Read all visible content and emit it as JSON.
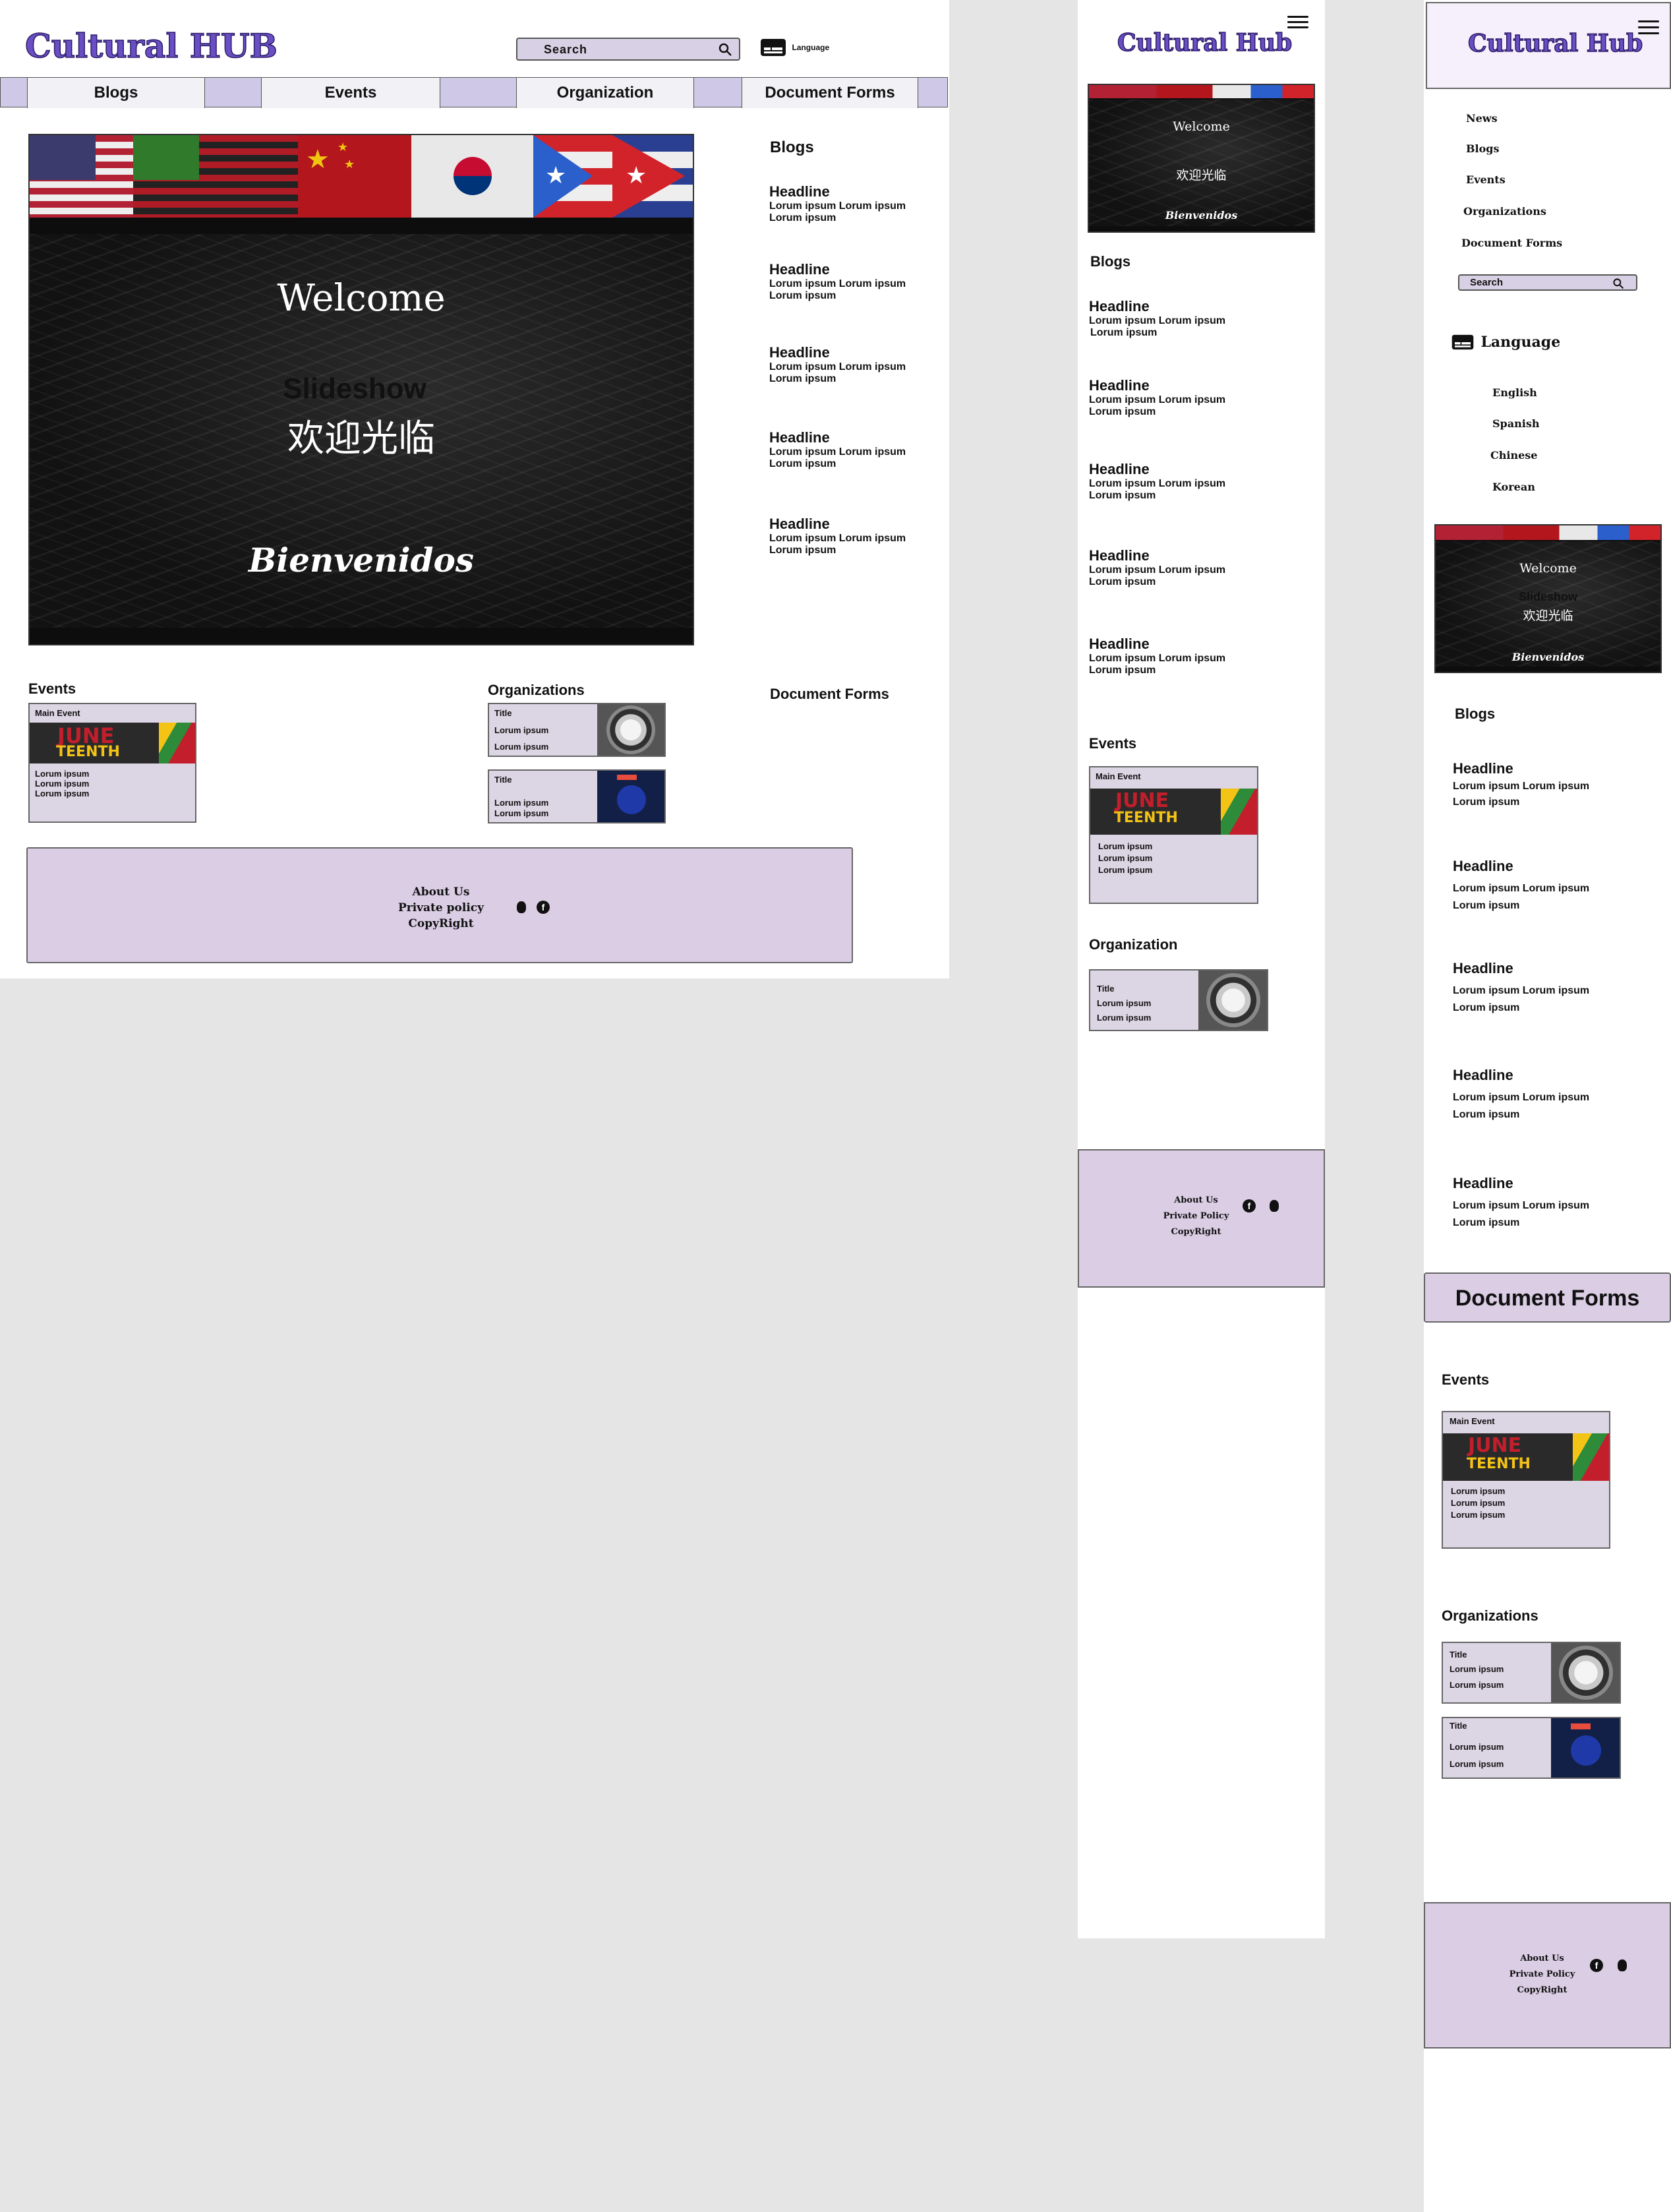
{
  "desktop": {
    "logo": "Cultural HUB",
    "search_placeholder": "Search",
    "language_label": "Language",
    "nav": [
      "Blogs",
      "Events",
      "Organization",
      "Document Forms"
    ],
    "hero": {
      "welcome": "Welcome",
      "slideshow": "Slideshow",
      "chinese": "欢迎光临",
      "spanish": "Bienvenidos"
    },
    "blogs_title": "Blogs",
    "blogs": [
      {
        "headline": "Headline",
        "l1": "Lorum ipsum Lorum ipsum",
        "l2": "Lorum ipsum"
      },
      {
        "headline": "Headline",
        "l1": "Lorum ipsum Lorum ipsum",
        "l2": "Lorum ipsum"
      },
      {
        "headline": "Headline",
        "l1": "Lorum ipsum Lorum ipsum",
        "l2": "Lorum ipsum"
      },
      {
        "headline": "Headline",
        "l1": "Lorum ipsum Lorum ipsum",
        "l2": "Lorum ipsum"
      },
      {
        "headline": "Headline",
        "l1": "Lorum ipsum Lorum ipsum",
        "l2": "Lorum ipsum"
      }
    ],
    "events_title": "Events",
    "main_event": {
      "label": "Main Event",
      "june": "JUNE",
      "teenth": "TEENTH",
      "lines": [
        "Lorum ipsum",
        "Lorum ipsum",
        "Lorum ipsum"
      ]
    },
    "organizations_title": "Organizations",
    "orgs": [
      {
        "title": "Title",
        "l1": "Lorum ipsum",
        "l2": "Lorum ipsum"
      },
      {
        "title": "Title",
        "l1": "Lorum ipsum",
        "l2": "Lorum ipsum"
      }
    ],
    "document_forms_title": "Document Forms",
    "footer": {
      "about": "About Us",
      "privacy": "Private policy",
      "copyright": "CopyRight"
    }
  },
  "tablet": {
    "logo": "Cultural Hub",
    "hero": {
      "welcome": "Welcome",
      "chinese": "欢迎光临",
      "spanish": "Bienvenidos"
    },
    "blogs_title": "Blogs",
    "blogs": [
      {
        "headline": "Headline",
        "l1": "Lorum ipsum Lorum ipsum",
        "l2": "Lorum ipsum"
      },
      {
        "headline": "Headline",
        "l1": "Lorum ipsum Lorum ipsum",
        "l2": "Lorum ipsum"
      },
      {
        "headline": "Headline",
        "l1": "Lorum ipsum Lorum ipsum",
        "l2": "Lorum ipsum"
      },
      {
        "headline": "Headline",
        "l1": "Lorum ipsum Lorum ipsum",
        "l2": "Lorum ipsum"
      },
      {
        "headline": "Headline",
        "l1": "Lorum ipsum Lorum ipsum",
        "l2": "Lorum ipsum"
      }
    ],
    "events_title": "Events",
    "main_event": {
      "label": "Main Event",
      "june": "JUNE",
      "teenth": "TEENTH",
      "lines": [
        "Lorum ipsum",
        "Lorum ipsum",
        "Lorum ipsum"
      ]
    },
    "organization_title": "Organization",
    "org": {
      "title": "Title",
      "l1": "Lorum ipsum",
      "l2": "Lorum ipsum"
    },
    "footer": {
      "about": "About Us",
      "privacy": "Private Policy",
      "copyright": "CopyRight"
    }
  },
  "mobile": {
    "logo": "Cultural Hub",
    "menu": [
      "News",
      "Blogs",
      "Events",
      "Organizations",
      "Document Forms"
    ],
    "search_placeholder": "Search",
    "language_label": "Language",
    "languages": [
      "English",
      "Spanish",
      "Chinese",
      "Korean"
    ],
    "hero": {
      "welcome": "Welcome",
      "slideshow": "Slideshow",
      "chinese": "欢迎光临",
      "spanish": "Bienvenidos"
    },
    "blogs_title": "Blogs",
    "blogs": [
      {
        "headline": "Headline",
        "l1": "Lorum ipsum Lorum ipsum",
        "l2": "Lorum ipsum"
      },
      {
        "headline": "Headline",
        "l1": "Lorum ipsum Lorum ipsum",
        "l2": "Lorum ipsum"
      },
      {
        "headline": "Headline",
        "l1": "Lorum ipsum Lorum ipsum",
        "l2": "Lorum ipsum"
      },
      {
        "headline": "Headline",
        "l1": "Lorum ipsum Lorum ipsum",
        "l2": "Lorum ipsum"
      },
      {
        "headline": "Headline",
        "l1": "Lorum ipsum Lorum ipsum",
        "l2": "Lorum ipsum"
      }
    ],
    "document_forms_title": "Document Forms",
    "events_title": "Events",
    "main_event": {
      "label": "Main Event",
      "june": "JUNE",
      "teenth": "TEENTH",
      "lines": [
        "Lorum ipsum",
        "Lorum ipsum",
        "Lorum ipsum"
      ]
    },
    "organizations_title": "Organizations",
    "orgs": [
      {
        "title": "Title",
        "l1": "Lorum ipsum",
        "l2": "Lorum ipsum"
      },
      {
        "title": "Title",
        "l1": "Lorum ipsum",
        "l2": "Lorum ipsum"
      }
    ],
    "footer": {
      "about": "About Us",
      "privacy": "Private Policy",
      "copyright": "CopyRight"
    }
  },
  "icons": [
    "search-icon",
    "language-icon",
    "menu-icon",
    "facebook-icon",
    "github-icon"
  ],
  "colors": {
    "accent": "#6a4fc4",
    "lilac": "#dacde4",
    "nav_fill": "#f2f1f6",
    "nav_spacer": "#cfc8e6"
  }
}
